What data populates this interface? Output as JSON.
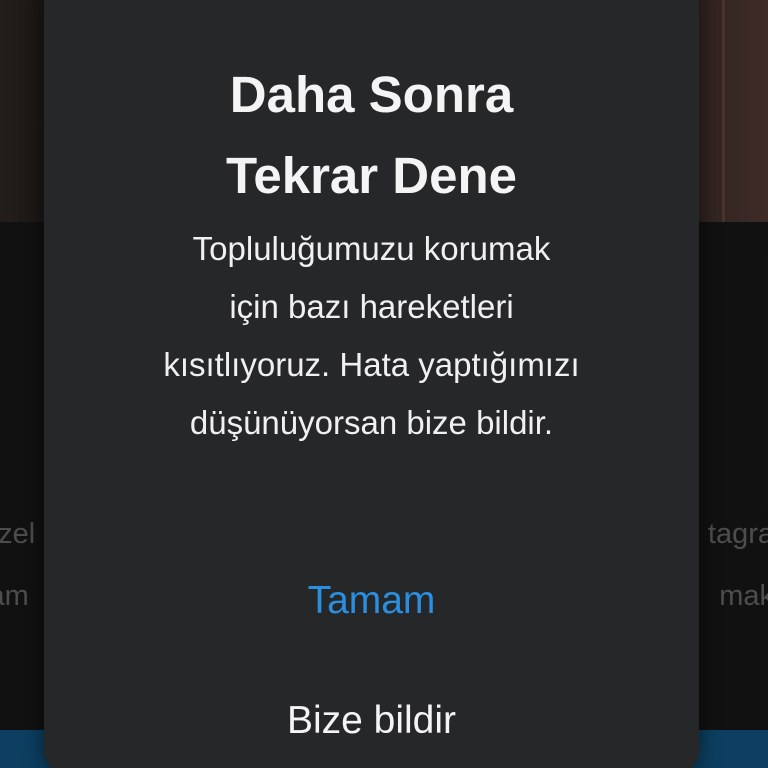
{
  "background": {
    "left_fragments": [
      "özel",
      "lam"
    ],
    "right_fragments": [
      "tagra",
      "mak"
    ]
  },
  "dialog": {
    "title": "Daha Sonra\nTekrar Dene",
    "message": "Topluluğumuzu korumak\niçin bazı hareketleri\nkısıtlıyoruz. Hata yaptığımızı\ndüşünüyorsan bize bildir.",
    "buttons": {
      "ok_label": "Tamam",
      "report_label": "Bize bildir"
    }
  },
  "colors": {
    "dialog_bg": "#262729",
    "accent_button": "#2a8fe0",
    "bottom_bar": "#0f4a73"
  }
}
